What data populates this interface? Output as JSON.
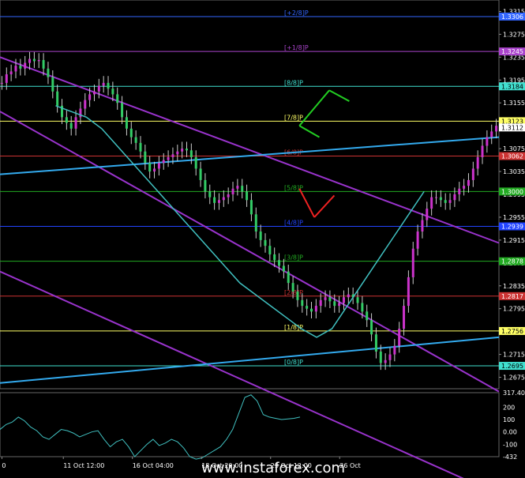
{
  "chart_data": [
    {
      "type": "candlestick",
      "ylim": [
        1.2655,
        1.3335
      ],
      "y_ticks": [
        "1.3315",
        "1.3275",
        "1.3235",
        "1.3195",
        "1.3155",
        "1.3112",
        "1.3075",
        "1.3035",
        "1.2995",
        "1.2955",
        "1.2915",
        "1.2875",
        "1.2835",
        "1.2795",
        "1.2756",
        "1.2715",
        "1.2675"
      ],
      "y_tick_values": [
        1.3315,
        1.3275,
        1.3235,
        1.3195,
        1.3155,
        1.3112,
        1.3075,
        1.3035,
        1.2995,
        1.2955,
        1.2915,
        1.2875,
        1.2835,
        1.2795,
        1.2756,
        1.2715,
        1.2675
      ],
      "x_ticks": [
        "0",
        "11 Oct 12:00",
        "16 Oct 04:00",
        "18 Oct 20:00",
        "23 Oct 12:00",
        "26 Oct"
      ],
      "x_tick_bars": [
        0,
        16,
        34,
        52,
        70,
        88
      ],
      "bar_count": 130,
      "murrey_levels": [
        {
          "label": "[8/8]P",
          "value": 1.3184,
          "color": "#40e0d0"
        },
        {
          "label": "[7/8]P",
          "value": 1.3123,
          "color": "#ffff66"
        },
        {
          "label": "[6/8]P",
          "value": 1.3062,
          "color": "#cc3333"
        },
        {
          "label": "[5/8]P",
          "value": 1.3,
          "color": "#22aa22"
        },
        {
          "label": "[4/8]P",
          "value": 1.2939,
          "color": "#2244ff"
        },
        {
          "label": "[3/8]P",
          "value": 1.2878,
          "color": "#22aa22"
        },
        {
          "label": "[2/8]P",
          "value": 1.2817,
          "color": "#cc3333"
        },
        {
          "label": "[1/8]P",
          "value": 1.2756,
          "color": "#ffff66"
        },
        {
          "label": "[0/8]P",
          "value": 1.2695,
          "color": "#40e0d0"
        },
        {
          "label": "[+1/8]P",
          "value": 1.3245,
          "color": "#aa44cc"
        },
        {
          "label": "[+2/8]P",
          "value": 1.3306,
          "color": "#3366ff"
        }
      ],
      "price_tags": [
        {
          "text": "1.3184",
          "value": 1.3184,
          "bg": "#40e0d0",
          "fg": "#000000"
        },
        {
          "text": "1.3123",
          "value": 1.3123,
          "bg": "#ffff66",
          "fg": "#000000"
        },
        {
          "text": "1.3112",
          "value": 1.3112,
          "bg": "#ffffff",
          "fg": "#000000"
        },
        {
          "text": "1.3062",
          "value": 1.3062,
          "bg": "#cc3333",
          "fg": "#ffffff"
        },
        {
          "text": "1.3000",
          "value": 1.3,
          "bg": "#22aa22",
          "fg": "#ffffff"
        },
        {
          "text": "1.2939",
          "value": 1.2939,
          "bg": "#2244ff",
          "fg": "#ffffff"
        },
        {
          "text": "1.2878",
          "value": 1.2878,
          "bg": "#22aa22",
          "fg": "#ffffff"
        },
        {
          "text": "1.2817",
          "value": 1.2817,
          "bg": "#cc3333",
          "fg": "#ffffff"
        },
        {
          "text": "1.2756",
          "value": 1.2756,
          "bg": "#ffff66",
          "fg": "#000000"
        },
        {
          "text": "1.2695",
          "value": 1.2695,
          "bg": "#40e0d0",
          "fg": "#000000"
        },
        {
          "text": "1.3245",
          "value": 1.3245,
          "bg": "#aa44cc",
          "fg": "#ffffff"
        },
        {
          "text": "1.3306",
          "value": 1.3306,
          "bg": "#3366ff",
          "fg": "#ffffff"
        }
      ],
      "closes": [
        1.319,
        1.3205,
        1.321,
        1.322,
        1.3215,
        1.3225,
        1.3232,
        1.3228,
        1.323,
        1.3215,
        1.32,
        1.3175,
        1.315,
        1.313,
        1.312,
        1.311,
        1.313,
        1.3145,
        1.316,
        1.317,
        1.3175,
        1.3185,
        1.319,
        1.318,
        1.317,
        1.3155,
        1.313,
        1.311,
        1.3095,
        1.3085,
        1.307,
        1.305,
        1.3035,
        1.304,
        1.305,
        1.3055,
        1.306,
        1.3065,
        1.307,
        1.3075,
        1.3072,
        1.306,
        1.304,
        1.302,
        1.3,
        1.299,
        1.298,
        1.2985,
        1.299,
        1.2995,
        1.3005,
        1.301,
        1.3,
        1.2985,
        1.296,
        1.293,
        1.2915,
        1.2905,
        1.289,
        1.288,
        1.287,
        1.286,
        1.284,
        1.2825,
        1.281,
        1.28,
        1.2795,
        1.279,
        1.28,
        1.281,
        1.2815,
        1.2808,
        1.28,
        1.2805,
        1.2815,
        1.282,
        1.2815,
        1.2805,
        1.279,
        1.2775,
        1.275,
        1.272,
        1.27,
        1.2705,
        1.2715,
        1.273,
        1.276,
        1.28,
        1.285,
        1.29,
        1.293,
        1.295,
        1.297,
        1.299,
        1.299,
        1.2985,
        1.298,
        1.2985,
        1.2995,
        1.3005,
        1.301,
        1.302,
        1.304,
        1.306,
        1.308,
        1.3095,
        1.3105,
        1.3115
      ],
      "ma": [
        1.315,
        1.314,
        1.313,
        1.311,
        1.308,
        1.305,
        1.302,
        1.299,
        1.296,
        1.293,
        1.29,
        1.287,
        1.284,
        1.282,
        1.28,
        1.278,
        1.276,
        1.2745,
        1.276,
        1.28,
        1.284,
        1.288,
        1.292,
        1.296,
        1.3
      ],
      "ma_start_bar": 14,
      "ma_step": 4,
      "channels": [
        {
          "x1": 0,
          "y1": 1.3235,
          "x2": 1.0,
          "y2": 1.291,
          "color": "#9933cc"
        },
        {
          "x1": 0,
          "y1": 1.314,
          "x2": 1.0,
          "y2": 1.265,
          "color": "#9933cc"
        },
        {
          "x1": 0,
          "y1": 1.286,
          "x2": 1.0,
          "y2": 1.247,
          "color": "#9933cc"
        },
        {
          "x1": 0,
          "y1": 1.303,
          "x2": 1.0,
          "y2": 1.3095,
          "color": "#33aaee"
        },
        {
          "x1": 0,
          "y1": 1.2665,
          "x2": 1.0,
          "y2": 1.2745,
          "color": "#33aaee"
        }
      ],
      "osc": {
        "ylim": [
          -200,
          317.4017
        ],
        "ticks": [
          "317.4017",
          "200",
          "100",
          "0.00",
          "-100",
          "-432"
        ],
        "tick_values": [
          317.4017,
          200,
          100,
          0,
          -100,
          -200
        ],
        "values": [
          20,
          60,
          80,
          120,
          90,
          40,
          10,
          -40,
          -60,
          -20,
          20,
          10,
          -10,
          -40,
          -20,
          0,
          10,
          -60,
          -120,
          -80,
          -60,
          -120,
          -200,
          -150,
          -100,
          -60,
          -110,
          -90,
          -60,
          -80,
          -130,
          -200,
          -220,
          -210,
          -180,
          -150,
          -120,
          -60,
          20,
          150,
          280,
          300,
          250,
          140,
          120,
          110,
          100,
          105,
          110,
          120
        ],
        "color": "#40c0c0"
      },
      "arrows": [
        {
          "color": "#22cc22",
          "from": [
            0.6,
            1.3115
          ],
          "to": [
            0.66,
            1.3177
          ]
        },
        {
          "color": "#22cc22",
          "from": [
            0.66,
            1.3177
          ],
          "to": [
            0.7,
            1.3158
          ]
        },
        {
          "color": "#22cc22",
          "from": [
            0.6,
            1.3115
          ],
          "to": [
            0.64,
            1.3095
          ]
        },
        {
          "color": "#ee2222",
          "from": [
            0.6,
            1.3005
          ],
          "to": [
            0.63,
            1.2955
          ]
        },
        {
          "color": "#ee2222",
          "from": [
            0.63,
            1.2955
          ],
          "to": [
            0.67,
            1.2993
          ]
        }
      ]
    }
  ],
  "watermark": "www.instaforex.com"
}
